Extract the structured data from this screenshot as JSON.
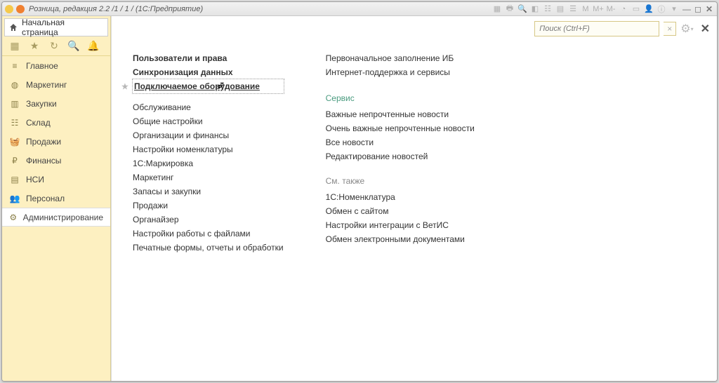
{
  "titlebar": {
    "title": "Розница, редакция 2.2 /1 / 1 /  (1С:Предприятие)"
  },
  "sidebar": {
    "start_label": "Начальная страница",
    "items": [
      {
        "label": "Главное"
      },
      {
        "label": "Маркетинг"
      },
      {
        "label": "Закупки"
      },
      {
        "label": "Склад"
      },
      {
        "label": "Продажи"
      },
      {
        "label": "Финансы"
      },
      {
        "label": "НСИ"
      },
      {
        "label": "Персонал"
      },
      {
        "label": "Администрирование"
      }
    ]
  },
  "search": {
    "placeholder": "Поиск (Ctrl+F)",
    "clear": "×"
  },
  "content": {
    "col1": {
      "linksA": [
        "Пользователи и права",
        "Синхронизация данных",
        "Подключаемое оборудование"
      ],
      "linksB": [
        "Обслуживание",
        "Общие настройки",
        "Организации и финансы",
        "Настройки номенклатуры",
        "1С:Маркировка",
        "Маркетинг",
        "Запасы и закупки",
        "Продажи",
        "Органайзер",
        "Настройки работы с файлами",
        "Печатные формы, отчеты и обработки"
      ]
    },
    "col2": {
      "linksA": [
        "Первоначальное заполнение ИБ",
        "Интернет-поддержка и сервисы"
      ],
      "section_service": "Сервис",
      "linksB": [
        "Важные непрочтенные новости",
        "Очень важные непрочтенные новости",
        "Все новости",
        "Редактирование новостей"
      ],
      "section_see_also": "См. также",
      "linksC": [
        "1С:Номенклатура",
        "Обмен с сайтом",
        "Настройки интеграции с ВетИС",
        "Обмен электронными документами"
      ]
    }
  }
}
